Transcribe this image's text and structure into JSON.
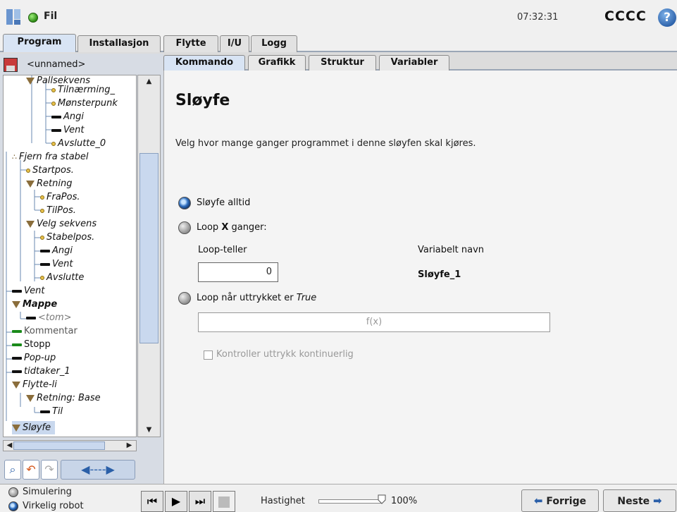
{
  "topbar": {
    "file_label": "Fil",
    "clock": "07:32:31",
    "robot_name": "CCCC",
    "help_icon": "?"
  },
  "main_tabs": [
    "Program",
    "Installasjon",
    "Flytte",
    "I/U",
    "Logg"
  ],
  "left_panel": {
    "program_name": "<unnamed>",
    "tree": [
      {
        "label": "Pallsekvens",
        "marker": "tri"
      },
      {
        "label": "Tilnærming_",
        "marker": "dot"
      },
      {
        "label": "Mønsterpunk",
        "marker": "dot"
      },
      {
        "label": "Angi",
        "marker": "bar"
      },
      {
        "label": "Vent",
        "marker": "bar"
      },
      {
        "label": "Avslutte_0",
        "marker": "dot"
      },
      {
        "label": "Fjern fra stabel",
        "marker": "dots"
      },
      {
        "label": "Startpos.",
        "marker": "dot"
      },
      {
        "label": "Retning",
        "marker": "tri"
      },
      {
        "label": "FraPos.",
        "marker": "dot"
      },
      {
        "label": "TilPos.",
        "marker": "dot"
      },
      {
        "label": "Velg sekvens",
        "marker": "tri"
      },
      {
        "label": "Stabelpos.",
        "marker": "dot"
      },
      {
        "label": "Angi",
        "marker": "bar"
      },
      {
        "label": "Vent",
        "marker": "bar"
      },
      {
        "label": "Avslutte",
        "marker": "dot"
      },
      {
        "label": "Vent",
        "marker": "bar"
      },
      {
        "label": "Mappe",
        "marker": "tri"
      },
      {
        "label": "<tom>",
        "marker": "bar"
      },
      {
        "label": "Kommentar",
        "marker": "bar-green"
      },
      {
        "label": "Stopp",
        "marker": "bar-green"
      },
      {
        "label": "Pop-up",
        "marker": "bar"
      },
      {
        "label": "tidtaker_1",
        "marker": "bar"
      },
      {
        "label": "Flytte-li",
        "marker": "tri"
      },
      {
        "label": "Retning: Base",
        "marker": "tri"
      },
      {
        "label": "Til",
        "marker": "bar"
      },
      {
        "label": "Sløyfe",
        "marker": "tri"
      }
    ],
    "tools": {
      "search_icon": "search-icon",
      "undo_icon": "undo-icon",
      "redo_icon": "redo-icon",
      "move_icon": "move-arrows-icon"
    }
  },
  "sub_tabs": [
    "Kommando",
    "Grafikk",
    "Struktur",
    "Variabler"
  ],
  "content": {
    "title": "Sløyfe",
    "description": "Velg hvor mange ganger programmet i denne sløyfen skal kjøres.",
    "option_always": "Sløyfe alltid",
    "option_x_prefix": "Loop ",
    "option_x_bold": "X",
    "option_x_suffix": " ganger:",
    "loop_counter_label": "Loop-teller",
    "variable_name_label": "Variabelt navn",
    "loop_counter_value": "0",
    "variable_name_value": "Sløyfe_1",
    "option_expr_prefix": "Loop når uttrykket er ",
    "option_expr_italic": "True",
    "expr_placeholder": "f(x)",
    "check_label": "Kontroller uttrykk kontinuerlig"
  },
  "bottombar": {
    "simulation_label": "Simulering",
    "real_robot_label": "Virkelig robot",
    "speed_label": "Hastighet",
    "speed_value": "100%",
    "speed_fraction": 1.0,
    "prev_label": "Forrige",
    "next_label": "Neste"
  }
}
